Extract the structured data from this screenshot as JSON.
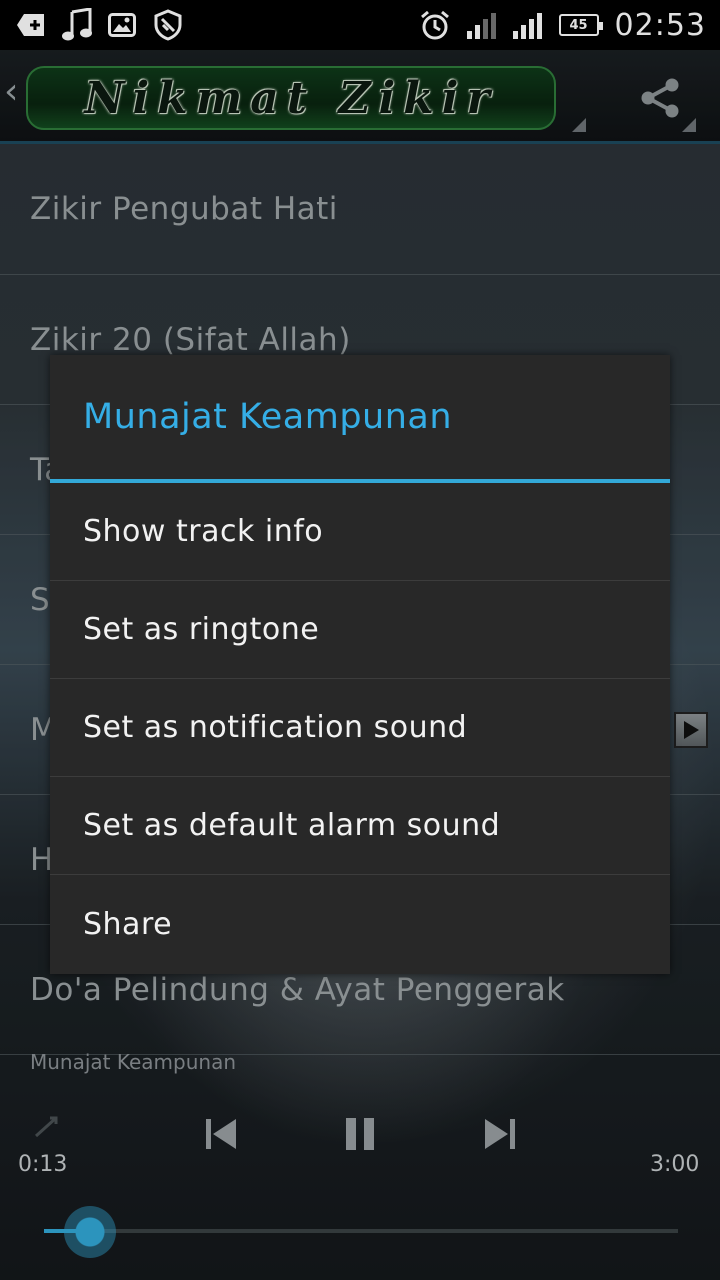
{
  "status_bar": {
    "battery_level": "45",
    "time": "02:53"
  },
  "action_bar": {
    "logo_text": "Nikmat Zikir"
  },
  "track_list": {
    "items": [
      "Zikir Pengubat Hati",
      "Zikir 20 (Sifat Allah)",
      "Ta",
      "So",
      "M",
      "H",
      "Do'a Pelindung & Ayat Penggerak"
    ]
  },
  "player": {
    "now_playing": "Munajat Keampunan",
    "elapsed": "0:13",
    "duration": "3:00",
    "progress": 0.072
  },
  "dialog": {
    "title": "Munajat Keampunan",
    "items": [
      "Show track info",
      "Set as ringtone",
      "Set as notification sound",
      "Set as default alarm sound",
      "Share"
    ]
  },
  "colors": {
    "accent": "#33a9d8",
    "dialog_background": "#282828",
    "logo_green": "#0f3a1a"
  }
}
